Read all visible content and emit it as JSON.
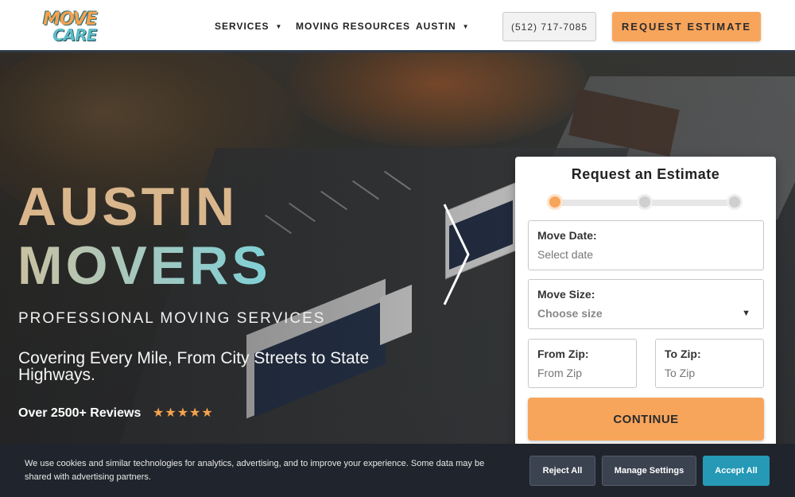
{
  "header": {
    "logo_top": "MOVE",
    "logo_bottom": "CARE",
    "nav": [
      {
        "label": "SERVICES",
        "dropdown": true
      },
      {
        "label": "MOVING RESOURCES",
        "dropdown": false
      },
      {
        "label": "AUSTIN",
        "dropdown": true
      }
    ],
    "phone": "(512) 717-7085",
    "cta": "REQUEST ESTIMATE"
  },
  "hero": {
    "title_line1": "AUSTIN",
    "title_line2": "MOVERS",
    "subtitle": "PROFESSIONAL MOVING SERVICES",
    "tagline": "Covering Every Mile, From City Streets to State Highways.",
    "reviews": "Over 2500+ Reviews",
    "stars": "★★★★★",
    "next_icon": "chevron-right-icon"
  },
  "estimate": {
    "title": "Request an Estimate",
    "steps_total": 3,
    "step_current": 1,
    "move_date": {
      "label": "Move Date:",
      "placeholder": "Select date"
    },
    "move_size": {
      "label": "Move Size:",
      "placeholder": "Choose size"
    },
    "from_zip": {
      "label": "From Zip:",
      "placeholder": "From Zip"
    },
    "to_zip": {
      "label": "To Zip:",
      "placeholder": "To Zip"
    },
    "continue_label": "CONTINUE"
  },
  "cookie": {
    "message": "We use cookies and similar technologies for analytics, advertising, and to improve your experience. Some data may be shared with advertising partners.",
    "reject": "Reject All",
    "manage": "Manage Settings",
    "accept": "Accept All"
  },
  "colors": {
    "accent_orange": "#f8a55c",
    "accent_teal": "#2599b6",
    "header_bg": "#ffffff",
    "cookie_bg": "#20252d"
  }
}
